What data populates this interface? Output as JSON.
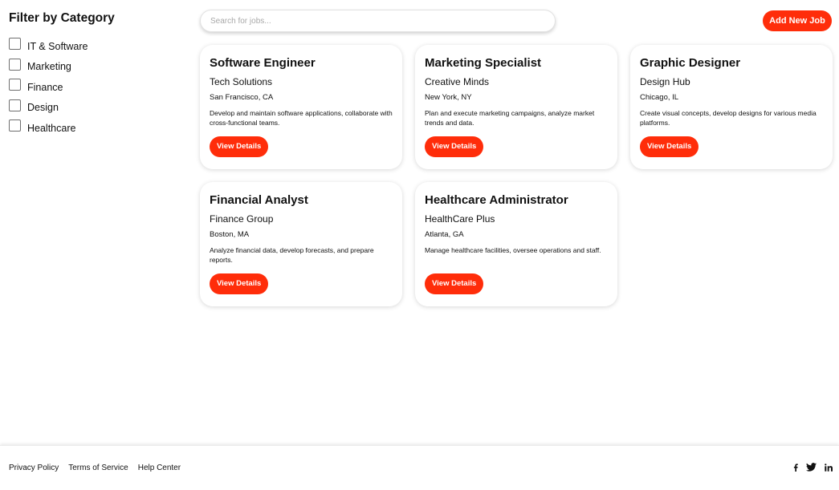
{
  "sidebar": {
    "title": "Filter by Category",
    "categories": [
      {
        "label": "IT & Software",
        "checked": false
      },
      {
        "label": "Marketing",
        "checked": false
      },
      {
        "label": "Finance",
        "checked": false
      },
      {
        "label": "Design",
        "checked": false
      },
      {
        "label": "Healthcare",
        "checked": false
      }
    ]
  },
  "search": {
    "placeholder": "Search for jobs...",
    "value": ""
  },
  "toolbar": {
    "add_label": "Add New Job"
  },
  "jobs": [
    {
      "title": "Software Engineer",
      "company": "Tech Solutions",
      "location": "San Francisco, CA",
      "description": "Develop and maintain software applications, collaborate with cross-functional teams.",
      "button": "View Details"
    },
    {
      "title": "Marketing Specialist",
      "company": "Creative Minds",
      "location": "New York, NY",
      "description": "Plan and execute marketing campaigns, analyze market trends and data.",
      "button": "View Details"
    },
    {
      "title": "Graphic Designer",
      "company": "Design Hub",
      "location": "Chicago, IL",
      "description": "Create visual concepts, develop designs for various media platforms.",
      "button": "View Details"
    },
    {
      "title": "Financial Analyst",
      "company": "Finance Group",
      "location": "Boston, MA",
      "description": "Analyze financial data, develop forecasts, and prepare reports.",
      "button": "View Details"
    },
    {
      "title": "Healthcare Administrator",
      "company": "HealthCare Plus",
      "location": "Atlanta, GA",
      "description": "Manage healthcare facilities, oversee operations and staff.",
      "button": "View Details"
    }
  ],
  "footer": {
    "links": [
      "Privacy Policy",
      "Terms of Service",
      "Help Center"
    ],
    "social": [
      "facebook-icon",
      "twitter-icon",
      "linkedin-icon"
    ]
  },
  "colors": {
    "accent": "#ff2d0a",
    "text": "#111111",
    "placeholder": "#a8a8a8"
  }
}
